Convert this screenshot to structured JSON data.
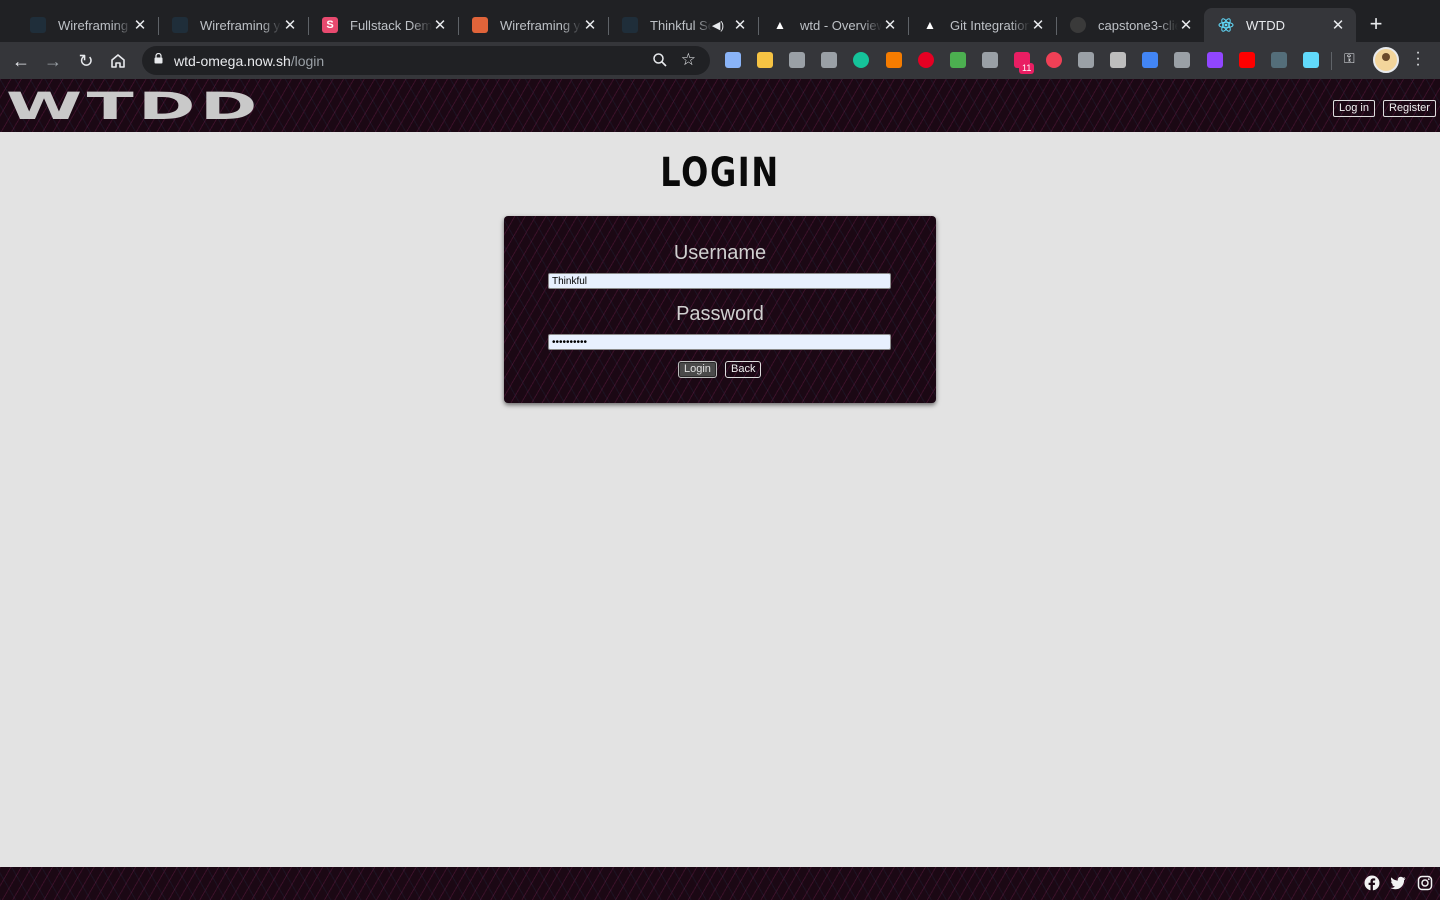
{
  "browser": {
    "tabs": [
      {
        "title": "Wireframing yo",
        "icon": "thinkful-icon",
        "color": "#1f2e3a"
      },
      {
        "title": "Wireframing yo",
        "icon": "thinkful-icon",
        "color": "#1f2e3a"
      },
      {
        "title": "Fullstack Demo",
        "icon": "s-icon",
        "color": "#e84a6f",
        "glyph": "S"
      },
      {
        "title": "Wireframing yo",
        "icon": "pencil-icon",
        "color": "#e0643a"
      },
      {
        "title": "Thinkful Se",
        "icon": "thinkful-icon",
        "color": "#1f2e3a"
      },
      {
        "title": "wtd - Overview",
        "icon": "vercel-icon",
        "color": "#ffffff"
      },
      {
        "title": "Git Integrations",
        "icon": "vercel-icon",
        "color": "#ffffff"
      },
      {
        "title": "capstone3-clie",
        "icon": "github-icon",
        "color": "#3a3a3a"
      },
      {
        "title": "WTDD",
        "icon": "react-icon",
        "color": "#61dafb"
      }
    ],
    "address": {
      "host": "wtd-omega.now.sh",
      "path": "/login"
    },
    "extension_badge": "11",
    "extensions": [
      {
        "name": "diamond-extension-icon",
        "color": "#8ab4f8"
      },
      {
        "name": "sticky-notes-extension-icon",
        "color": "#f6c343"
      },
      {
        "name": "pen-extension-icon",
        "color": "#9aa0a6"
      },
      {
        "name": "buffer-extension-icon",
        "color": "#9aa0a6"
      },
      {
        "name": "grammarly-extension-icon",
        "color": "#15c39a"
      },
      {
        "name": "chart-extension-icon",
        "color": "#f57c00"
      },
      {
        "name": "pinterest-extension-icon",
        "color": "#e60023"
      },
      {
        "name": "color-wheel-extension-icon",
        "color": "#4caf50"
      },
      {
        "name": "bulb-extension-icon",
        "color": "#9aa0a6"
      },
      {
        "name": "nh-extension-icon",
        "color": "#e91e63"
      },
      {
        "name": "pocket-extension-icon",
        "color": "#ef4056"
      },
      {
        "name": "font-extension-icon",
        "color": "#9aa0a6"
      },
      {
        "name": "page-extension-icon",
        "color": "#bdbdbd"
      },
      {
        "name": "drop-extension-icon",
        "color": "#4285f4"
      },
      {
        "name": "tag-extension-icon",
        "color": "#9aa0a6"
      },
      {
        "name": "twitch-extension-icon",
        "color": "#9146ff"
      },
      {
        "name": "youtube-extension-icon",
        "color": "#ff0000"
      },
      {
        "name": "type-extension-icon",
        "color": "#546e7a"
      },
      {
        "name": "react-devtools-extension-icon",
        "color": "#61dafb"
      }
    ]
  },
  "site": {
    "logo": "WTDD",
    "nav": {
      "login": "Log in",
      "register": "Register"
    },
    "accent_color": "#1b0814"
  },
  "login": {
    "title": "LOGIN",
    "username_label": "Username",
    "username_value": "Thinkful",
    "password_label": "Password",
    "password_value": "••••••••••",
    "submit_label": "Login",
    "back_label": "Back"
  },
  "footer": {
    "icons": [
      "facebook-icon",
      "twitter-icon",
      "instagram-icon"
    ]
  }
}
